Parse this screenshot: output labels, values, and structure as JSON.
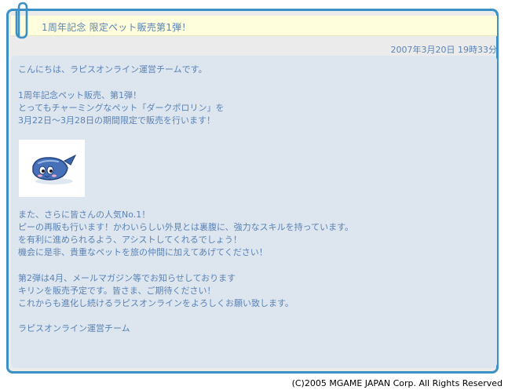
{
  "title": "1周年記念 限定ペット販売第1弾！",
  "date": "2007年3月20日 19時33分",
  "body": {
    "p1": [
      "こんにちは、ラピスオンライン運営チームです。"
    ],
    "p2": [
      "1周年記念ペット販売、第1弾！",
      "とってもチャーミングなペット「ダークポロリン」を",
      "3月22日～3月28日の期間限定で販売を行います！"
    ],
    "p3": [
      "また、さらに皆さんの人気No.1！",
      "ピーの再販も行います！かわいらしい外見とは裏腹に、強力なスキルを持っています。",
      "を有利に進められるよう、アシストしてくれるでしょう！",
      "機会に是非、貴重なペットを旅の仲間に加えてあげてください！"
    ],
    "p4": [
      "第2弾は4月、メールマガジン等でお知らせしております",
      "キリンを販売予定です。皆さま、ご期待ください！",
      "これからも進化し続けるラピスオンラインをよろしくお願い致します。"
    ],
    "signature": "ラピスオンライン運営チーム"
  },
  "image": {
    "icon": "dark-pororin-pet-icon"
  },
  "footer": {
    "copyright": "(C)2005 MGAME JAPAN Corp. All Rights Reserved"
  },
  "colors": {
    "frame_border": "#3b90c6",
    "text": "#5a83b5",
    "title_bg": "#fefedc",
    "content_bg": "#dde5ef",
    "panel_bg": "#ebebeb"
  }
}
